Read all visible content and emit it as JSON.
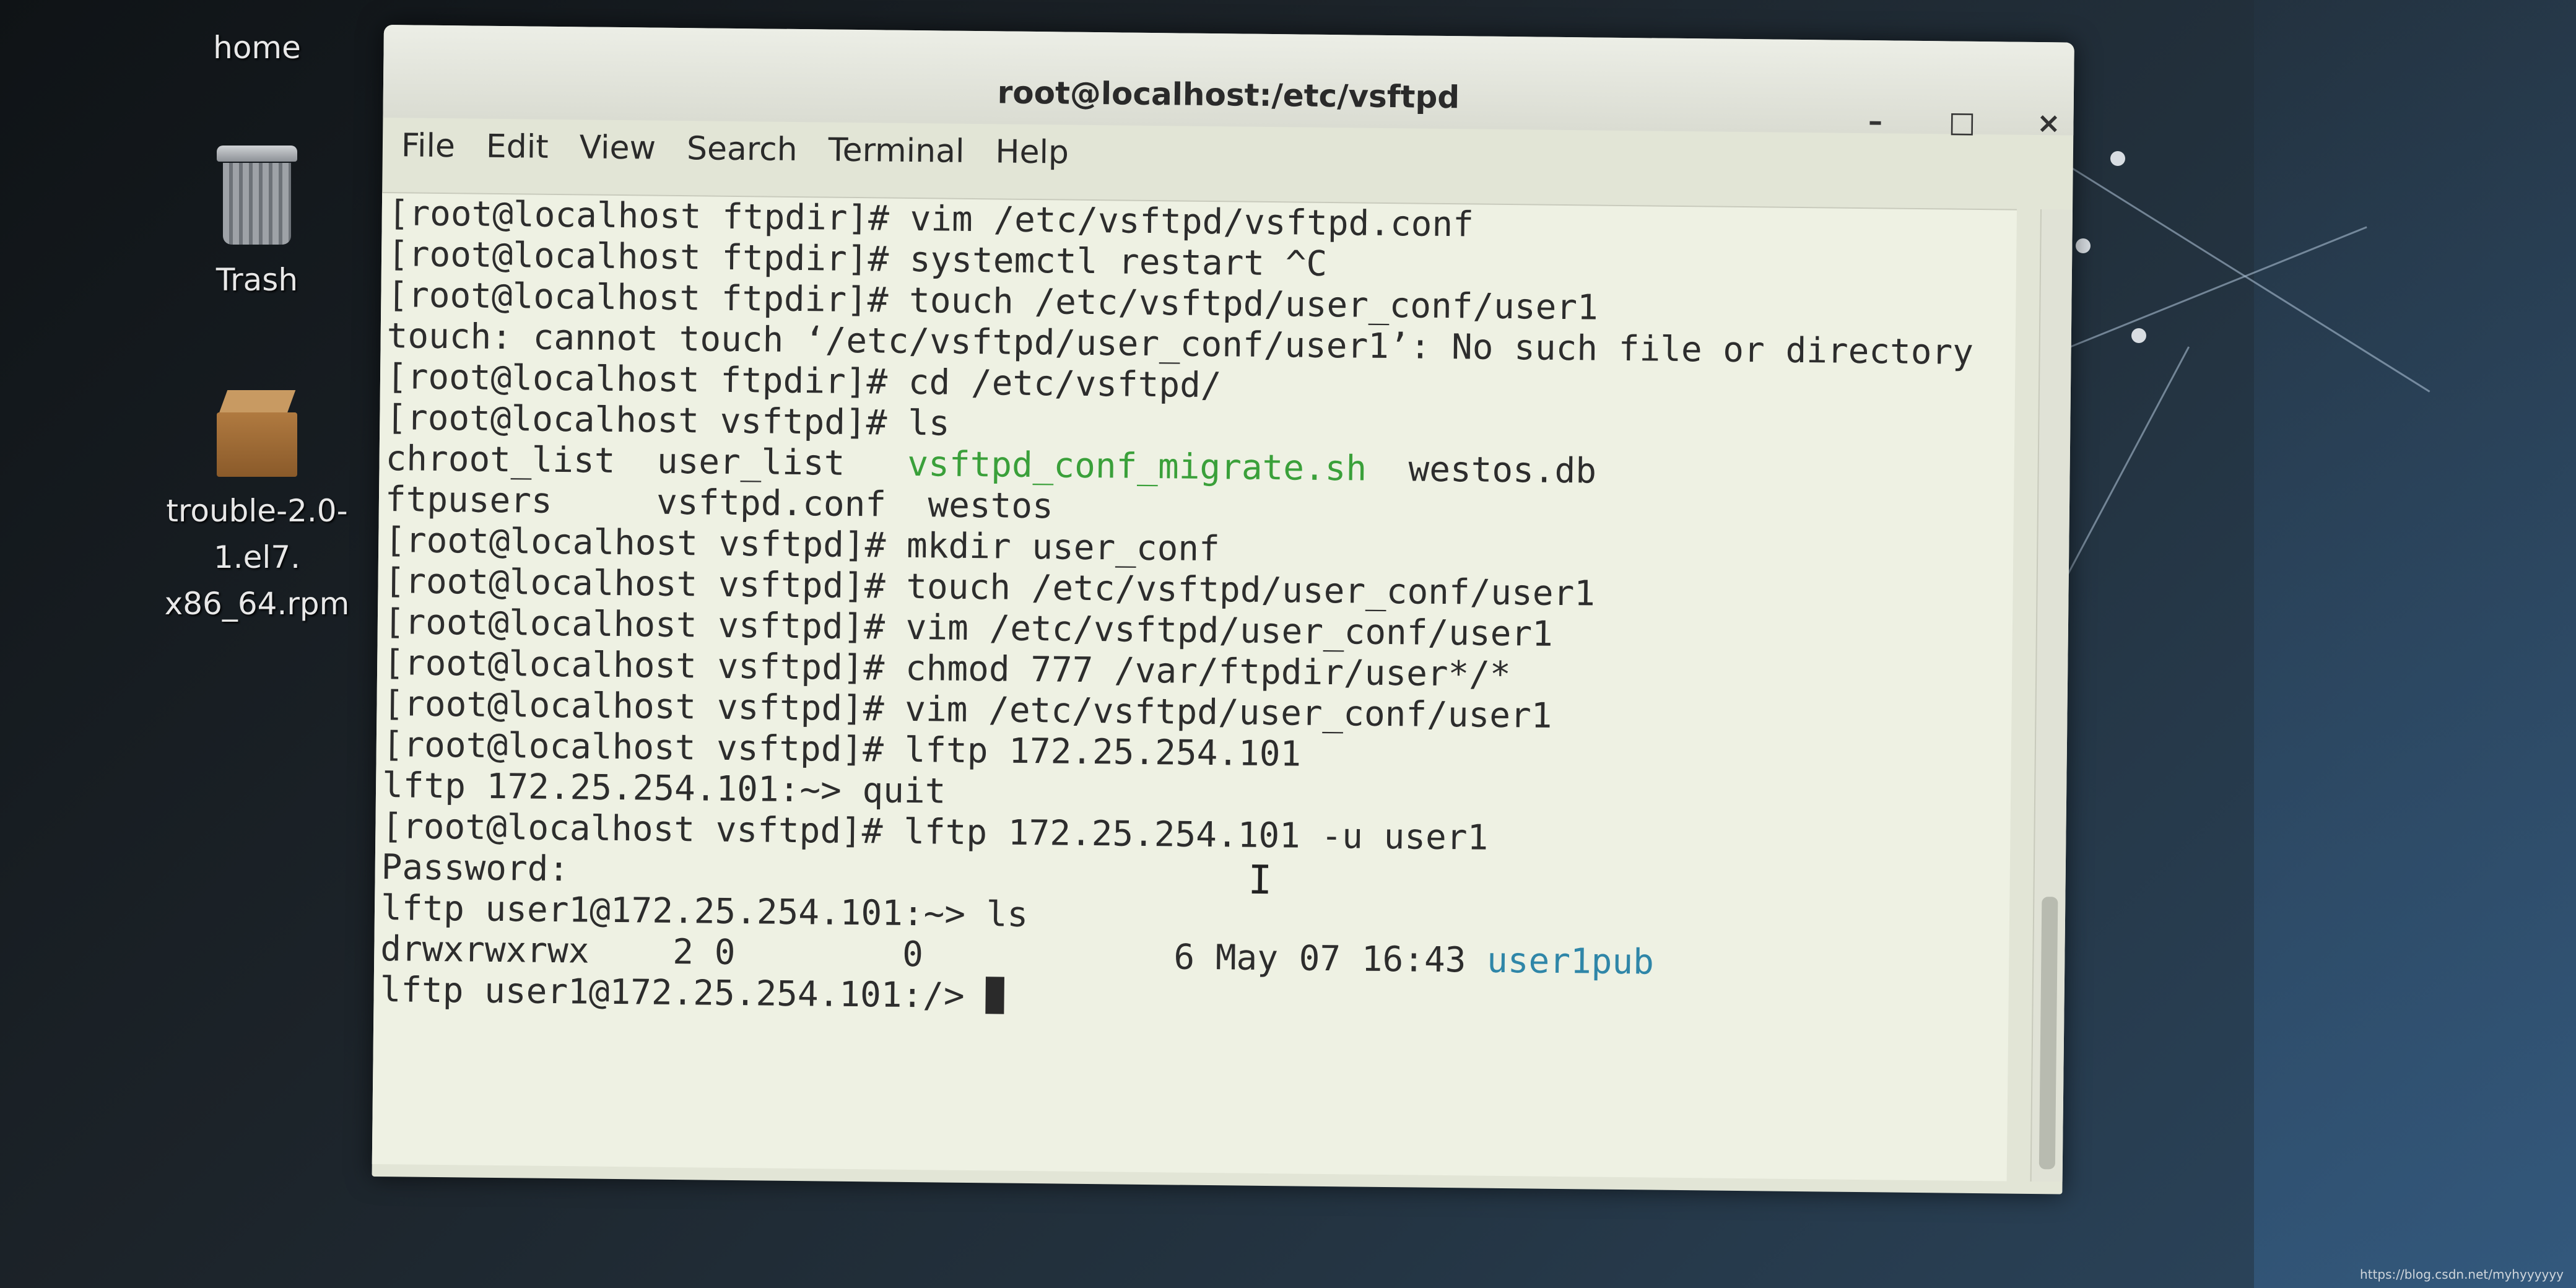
{
  "desktop": {
    "icons": [
      {
        "label": "home",
        "icon": "home-folder-icon"
      },
      {
        "label": "Trash",
        "icon": "trash-icon"
      },
      {
        "label_line1": "trouble-2.0-1.el7.",
        "label_line2": "x86_64.rpm",
        "icon": "package-icon"
      }
    ]
  },
  "window": {
    "title": "root@localhost:/etc/vsftpd",
    "minimize_glyph": "–",
    "maximize_glyph": "□",
    "close_glyph": "×",
    "menu": [
      "File",
      "Edit",
      "View",
      "Search",
      "Terminal",
      "Help"
    ]
  },
  "terminal": {
    "lines": [
      "[root@localhost ftpdir]# vim /etc/vsftpd/vsftpd.conf",
      "[root@localhost ftpdir]# systemctl restart ^C",
      "[root@localhost ftpdir]# touch /etc/vsftpd/user_conf/user1",
      "touch: cannot touch ‘/etc/vsftpd/user_conf/user1’: No such file or directory",
      "[root@localhost ftpdir]# cd /etc/vsftpd/",
      "[root@localhost vsftpd]# ls"
    ],
    "ls_row1": {
      "a": "chroot_list  user_list   ",
      "script": "vsftpd_conf_migrate.sh",
      "b": "  westos.db"
    },
    "ls_row2": "ftpusers     vsftpd.conf  westos",
    "lines2": [
      "[root@localhost vsftpd]# mkdir user_conf",
      "[root@localhost vsftpd]# touch /etc/vsftpd/user_conf/user1",
      "[root@localhost vsftpd]# vim /etc/vsftpd/user_conf/user1",
      "[root@localhost vsftpd]# chmod 777 /var/ftpdir/user*/*",
      "[root@localhost vsftpd]# vim /etc/vsftpd/user_conf/user1",
      "[root@localhost vsftpd]# lftp 172.25.254.101",
      "lftp 172.25.254.101:~> quit",
      "[root@localhost vsftpd]# lftp 172.25.254.101 -u user1",
      "Password:",
      "lftp user1@172.25.254.101:~> ls"
    ],
    "dir_entry": {
      "meta": "drwxrwxrwx    2 0        0            6 May 07 16:43 ",
      "name": "user1pub"
    },
    "prompt": "lftp user1@172.25.254.101:/> "
  },
  "watermark": "https://blog.csdn.net/myhyyyyyy"
}
